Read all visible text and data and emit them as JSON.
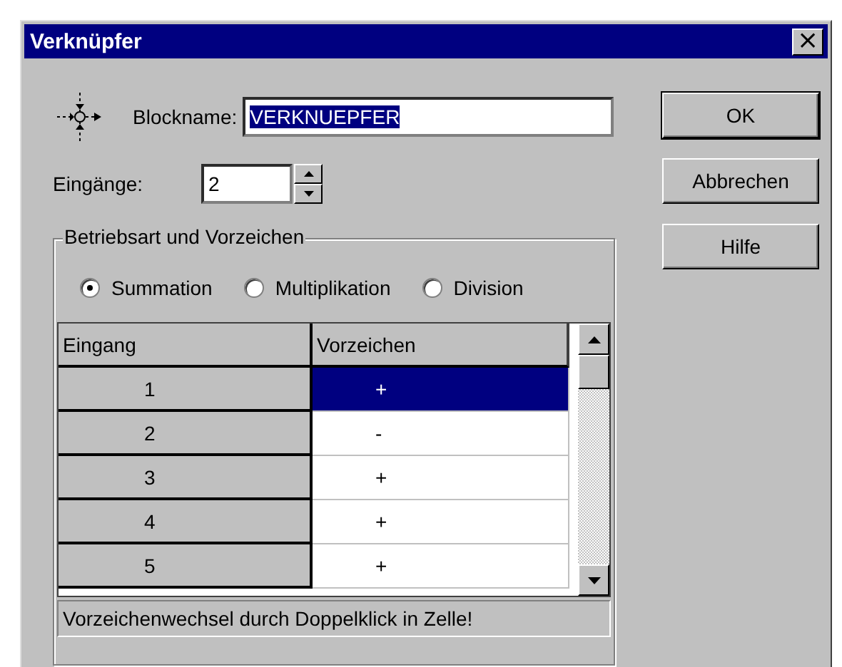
{
  "window": {
    "title": "Verknüpfer",
    "close": "×"
  },
  "blockname": {
    "label": "Blockname:",
    "value": "VERKNUEPFER",
    "selected": true
  },
  "inputs": {
    "label": "Eingänge:",
    "value": "2"
  },
  "buttons": [
    "OK",
    "Abbrechen",
    "Hilfe"
  ],
  "group": {
    "title": "Betriebsart und Vorzeichen",
    "modes": [
      {
        "label": "Summation",
        "selected": true
      },
      {
        "label": "Multiplikation",
        "selected": false
      },
      {
        "label": "Division",
        "selected": false
      }
    ],
    "table": {
      "columns": [
        "Eingang",
        "Vorzeichen"
      ],
      "rows": [
        {
          "eingang": "1",
          "vorzeichen": "+",
          "selected": true
        },
        {
          "eingang": "2",
          "vorzeichen": "-",
          "selected": false
        },
        {
          "eingang": "3",
          "vorzeichen": "+",
          "selected": false
        },
        {
          "eingang": "4",
          "vorzeichen": "+",
          "selected": false
        },
        {
          "eingang": "5",
          "vorzeichen": "+",
          "selected": false
        }
      ]
    },
    "hint": "Vorzeichenwechsel durch Doppelklick in Zelle!"
  }
}
